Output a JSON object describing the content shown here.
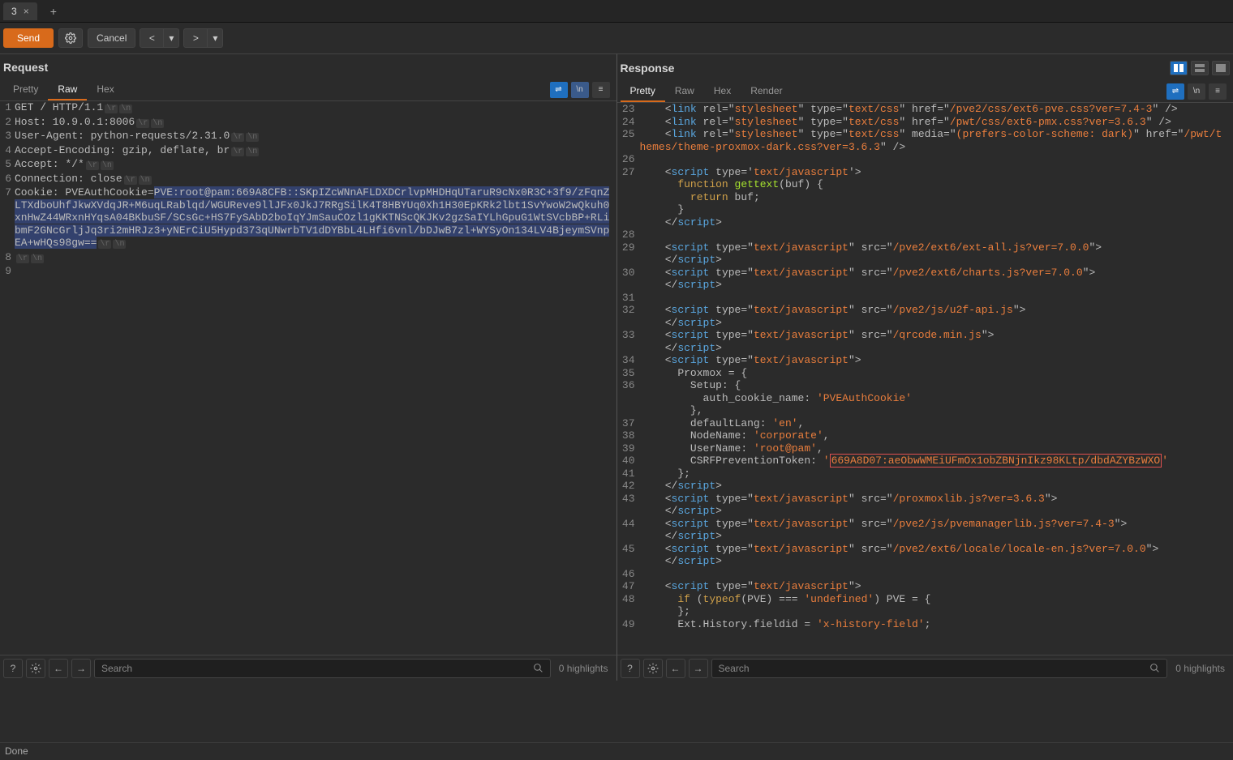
{
  "tab": {
    "label": "3",
    "close": "×",
    "add": "+"
  },
  "toolbar": {
    "send": "Send",
    "cancel": "Cancel",
    "back": "<",
    "fwd": ">",
    "dd": "▾"
  },
  "request": {
    "title": "Request",
    "tabs": {
      "pretty": "Pretty",
      "raw": "Raw",
      "hex": "Hex"
    },
    "lines": [
      {
        "n": 1,
        "text": "GET / HTTP/1.1",
        "crlf": true
      },
      {
        "n": 2,
        "text": "Host: 10.9.0.1:8006",
        "crlf": true
      },
      {
        "n": 3,
        "text": "User-Agent: python-requests/2.31.0",
        "crlf": true
      },
      {
        "n": 4,
        "text": "Accept-Encoding: gzip, deflate, br",
        "crlf": true
      },
      {
        "n": 5,
        "text": "Accept: */*",
        "crlf": true
      },
      {
        "n": 6,
        "text": "Connection: close",
        "crlf": true
      },
      {
        "n": 7,
        "text": "Cookie: PVEAuthCookie=",
        "sel": "PVE:root@pam:669A8CFB::SKpIZcWNnAFLDXDCrlvpMHDHqUTaruR9cNx0R3C+3f9/zFqnZLTXdboUhfJkwXVdqJR+M6uqLRablqd/WGUReve9llJFx0JkJ7RRgSilK4T8HBYUq0Xh1H30EpKRk2lbt1SvYwoW2wQkuh0xnHwZ44WRxnHYqsA04BKbuSF/SCsGc+HS7FySAbD2boIqYJmSauCOzl1gKKTNScQKJKv2gzSaIYLhGpuG1WtSVcbBP+RLibmF2GNcGrljJq3ri2mHRJz3+yNErCiU5Hypd373qUNwrbTV1dDYBbL4LHfi6vnl/bDJwB7zl+WYSyOn134LV4BjeymSVnpEA+wHQs98gw==",
        "crlf": true
      },
      {
        "n": 8,
        "text": "",
        "crlf": true
      },
      {
        "n": 9,
        "text": ""
      }
    ]
  },
  "response": {
    "title": "Response",
    "tabs": {
      "pretty": "Pretty",
      "raw": "Raw",
      "hex": "Hex",
      "render": "Render"
    },
    "lines": [
      {
        "n": 23,
        "segs": [
          {
            "t": "    <"
          },
          {
            "t": "link",
            "c": "t-tag"
          },
          {
            "t": " rel=\""
          },
          {
            "t": "stylesheet",
            "c": "t-str"
          },
          {
            "t": "\" type=\""
          },
          {
            "t": "text/css",
            "c": "t-str"
          },
          {
            "t": "\" href=\""
          },
          {
            "t": "/pve2/css/ext6-pve.css?ver=7.4-3",
            "c": "t-str"
          },
          {
            "t": "\" />"
          }
        ]
      },
      {
        "n": 24,
        "segs": [
          {
            "t": "    <"
          },
          {
            "t": "link",
            "c": "t-tag"
          },
          {
            "t": " rel=\""
          },
          {
            "t": "stylesheet",
            "c": "t-str"
          },
          {
            "t": "\" type=\""
          },
          {
            "t": "text/css",
            "c": "t-str"
          },
          {
            "t": "\" href=\""
          },
          {
            "t": "/pwt/css/ext6-pmx.css?ver=3.6.3",
            "c": "t-str"
          },
          {
            "t": "\" />"
          }
        ]
      },
      {
        "n": 25,
        "segs": [
          {
            "t": "    <"
          },
          {
            "t": "link",
            "c": "t-tag"
          },
          {
            "t": " rel=\""
          },
          {
            "t": "stylesheet",
            "c": "t-str"
          },
          {
            "t": "\" type=\""
          },
          {
            "t": "text/css",
            "c": "t-str"
          },
          {
            "t": "\" media=\""
          },
          {
            "t": "(prefers-color-scheme: dark)",
            "c": "t-str"
          },
          {
            "t": "\" href=\""
          },
          {
            "t": "/pwt/themes/theme-proxmox-dark.css?ver=3.6.3",
            "c": "t-str"
          },
          {
            "t": "\" />"
          }
        ]
      },
      {
        "n": 26,
        "segs": [
          {
            "t": ""
          }
        ]
      },
      {
        "n": 27,
        "segs": [
          {
            "t": "    <"
          },
          {
            "t": "script",
            "c": "t-tag"
          },
          {
            "t": " type='"
          },
          {
            "t": "text/javascript",
            "c": "t-str"
          },
          {
            "t": "'>"
          }
        ]
      },
      {
        "n": "",
        "segs": [
          {
            "t": "      "
          },
          {
            "t": "function",
            "c": "t-kw"
          },
          {
            "t": " "
          },
          {
            "t": "gettext",
            "c": "t-fn"
          },
          {
            "t": "(buf) {"
          }
        ]
      },
      {
        "n": "",
        "segs": [
          {
            "t": "        "
          },
          {
            "t": "return",
            "c": "t-kw"
          },
          {
            "t": " buf;"
          }
        ]
      },
      {
        "n": "",
        "segs": [
          {
            "t": "      }"
          }
        ]
      },
      {
        "n": "",
        "segs": [
          {
            "t": "    </"
          },
          {
            "t": "script",
            "c": "t-tag"
          },
          {
            "t": ">"
          }
        ]
      },
      {
        "n": 28,
        "segs": [
          {
            "t": ""
          }
        ]
      },
      {
        "n": 29,
        "segs": [
          {
            "t": "    <"
          },
          {
            "t": "script",
            "c": "t-tag"
          },
          {
            "t": " type=\""
          },
          {
            "t": "text/javascript",
            "c": "t-str"
          },
          {
            "t": "\" src=\""
          },
          {
            "t": "/pve2/ext6/ext-all.js?ver=7.0.0",
            "c": "t-str"
          },
          {
            "t": "\">"
          }
        ]
      },
      {
        "n": "",
        "segs": [
          {
            "t": "    </"
          },
          {
            "t": "script",
            "c": "t-tag"
          },
          {
            "t": ">"
          }
        ]
      },
      {
        "n": 30,
        "segs": [
          {
            "t": "    <"
          },
          {
            "t": "script",
            "c": "t-tag"
          },
          {
            "t": " type=\""
          },
          {
            "t": "text/javascript",
            "c": "t-str"
          },
          {
            "t": "\" src=\""
          },
          {
            "t": "/pve2/ext6/charts.js?ver=7.0.0",
            "c": "t-str"
          },
          {
            "t": "\">"
          }
        ]
      },
      {
        "n": "",
        "segs": [
          {
            "t": "    </"
          },
          {
            "t": "script",
            "c": "t-tag"
          },
          {
            "t": ">"
          }
        ]
      },
      {
        "n": 31,
        "segs": [
          {
            "t": ""
          }
        ]
      },
      {
        "n": 32,
        "segs": [
          {
            "t": "    <"
          },
          {
            "t": "script",
            "c": "t-tag"
          },
          {
            "t": " type=\""
          },
          {
            "t": "text/javascript",
            "c": "t-str"
          },
          {
            "t": "\" src=\""
          },
          {
            "t": "/pve2/js/u2f-api.js",
            "c": "t-str"
          },
          {
            "t": "\">"
          }
        ]
      },
      {
        "n": "",
        "segs": [
          {
            "t": "    </"
          },
          {
            "t": "script",
            "c": "t-tag"
          },
          {
            "t": ">"
          }
        ]
      },
      {
        "n": 33,
        "segs": [
          {
            "t": "    <"
          },
          {
            "t": "script",
            "c": "t-tag"
          },
          {
            "t": " type=\""
          },
          {
            "t": "text/javascript",
            "c": "t-str"
          },
          {
            "t": "\" src=\""
          },
          {
            "t": "/qrcode.min.js",
            "c": "t-str"
          },
          {
            "t": "\">"
          }
        ]
      },
      {
        "n": "",
        "segs": [
          {
            "t": "    </"
          },
          {
            "t": "script",
            "c": "t-tag"
          },
          {
            "t": ">"
          }
        ]
      },
      {
        "n": 34,
        "segs": [
          {
            "t": "    <"
          },
          {
            "t": "script",
            "c": "t-tag"
          },
          {
            "t": " type=\""
          },
          {
            "t": "text/javascript",
            "c": "t-str"
          },
          {
            "t": "\">"
          }
        ]
      },
      {
        "n": 35,
        "segs": [
          {
            "t": "      Proxmox = {"
          }
        ]
      },
      {
        "n": 36,
        "segs": [
          {
            "t": "        Setup: {"
          }
        ]
      },
      {
        "n": "",
        "segs": [
          {
            "t": "          auth_cookie_name: "
          },
          {
            "t": "'PVEAuthCookie'",
            "c": "t-str"
          }
        ]
      },
      {
        "n": "",
        "segs": [
          {
            "t": "        },"
          }
        ]
      },
      {
        "n": 37,
        "segs": [
          {
            "t": "        defaultLang: "
          },
          {
            "t": "'en'",
            "c": "t-str"
          },
          {
            "t": ","
          }
        ]
      },
      {
        "n": 38,
        "segs": [
          {
            "t": "        NodeName: "
          },
          {
            "t": "'corporate'",
            "c": "t-str"
          },
          {
            "t": ","
          }
        ]
      },
      {
        "n": 39,
        "segs": [
          {
            "t": "        UserName: "
          },
          {
            "t": "'root@pam'",
            "c": "t-str"
          },
          {
            "t": ","
          }
        ]
      },
      {
        "n": 40,
        "segs": [
          {
            "t": "        CSRFPreventionToken: "
          },
          {
            "t": "'",
            "c": "t-str"
          },
          {
            "t": "669A8D07:aeObwWMEiUFmOx1obZBNjnIkz98KLtp/dbdAZYBzWXO",
            "c": "hl-box"
          },
          {
            "t": "'",
            "c": "t-str"
          }
        ]
      },
      {
        "n": 41,
        "segs": [
          {
            "t": "      };"
          }
        ]
      },
      {
        "n": 42,
        "segs": [
          {
            "t": "    </"
          },
          {
            "t": "script",
            "c": "t-tag"
          },
          {
            "t": ">"
          }
        ]
      },
      {
        "n": 43,
        "segs": [
          {
            "t": "    <"
          },
          {
            "t": "script",
            "c": "t-tag"
          },
          {
            "t": " type=\""
          },
          {
            "t": "text/javascript",
            "c": "t-str"
          },
          {
            "t": "\" src=\""
          },
          {
            "t": "/proxmoxlib.js?ver=3.6.3",
            "c": "t-str"
          },
          {
            "t": "\">"
          }
        ]
      },
      {
        "n": "",
        "segs": [
          {
            "t": "    </"
          },
          {
            "t": "script",
            "c": "t-tag"
          },
          {
            "t": ">"
          }
        ]
      },
      {
        "n": 44,
        "segs": [
          {
            "t": "    <"
          },
          {
            "t": "script",
            "c": "t-tag"
          },
          {
            "t": " type=\""
          },
          {
            "t": "text/javascript",
            "c": "t-str"
          },
          {
            "t": "\" src=\""
          },
          {
            "t": "/pve2/js/pvemanagerlib.js?ver=7.4-3",
            "c": "t-str"
          },
          {
            "t": "\">"
          }
        ]
      },
      {
        "n": "",
        "segs": [
          {
            "t": "    </"
          },
          {
            "t": "script",
            "c": "t-tag"
          },
          {
            "t": ">"
          }
        ]
      },
      {
        "n": 45,
        "segs": [
          {
            "t": "    <"
          },
          {
            "t": "script",
            "c": "t-tag"
          },
          {
            "t": " type=\""
          },
          {
            "t": "text/javascript",
            "c": "t-str"
          },
          {
            "t": "\" src=\""
          },
          {
            "t": "/pve2/ext6/locale/locale-en.js?ver=7.0.0",
            "c": "t-str"
          },
          {
            "t": "\">"
          }
        ]
      },
      {
        "n": "",
        "segs": [
          {
            "t": "    </"
          },
          {
            "t": "script",
            "c": "t-tag"
          },
          {
            "t": ">"
          }
        ]
      },
      {
        "n": 46,
        "segs": [
          {
            "t": ""
          }
        ]
      },
      {
        "n": 47,
        "segs": [
          {
            "t": "    <"
          },
          {
            "t": "script",
            "c": "t-tag"
          },
          {
            "t": " type=\""
          },
          {
            "t": "text/javascript",
            "c": "t-str"
          },
          {
            "t": "\">"
          }
        ]
      },
      {
        "n": 48,
        "segs": [
          {
            "t": "      "
          },
          {
            "t": "if",
            "c": "t-kw"
          },
          {
            "t": " ("
          },
          {
            "t": "typeof",
            "c": "t-kw"
          },
          {
            "t": "(PVE) === "
          },
          {
            "t": "'undefined'",
            "c": "t-str"
          },
          {
            "t": ") PVE = {"
          }
        ]
      },
      {
        "n": "",
        "segs": [
          {
            "t": "      };"
          }
        ]
      },
      {
        "n": 49,
        "segs": [
          {
            "t": "      Ext.History.fieldid = "
          },
          {
            "t": "'x-history-field'",
            "c": "t-str"
          },
          {
            "t": ";"
          }
        ]
      }
    ]
  },
  "footer": {
    "search": "Search",
    "highlights": "0 highlights"
  },
  "status": "Done",
  "crlf": {
    "cr": "\\r",
    "lf": "\\n"
  },
  "mini": {
    "wrap": "⇌",
    "n": "\\n",
    "menu": "≡"
  }
}
